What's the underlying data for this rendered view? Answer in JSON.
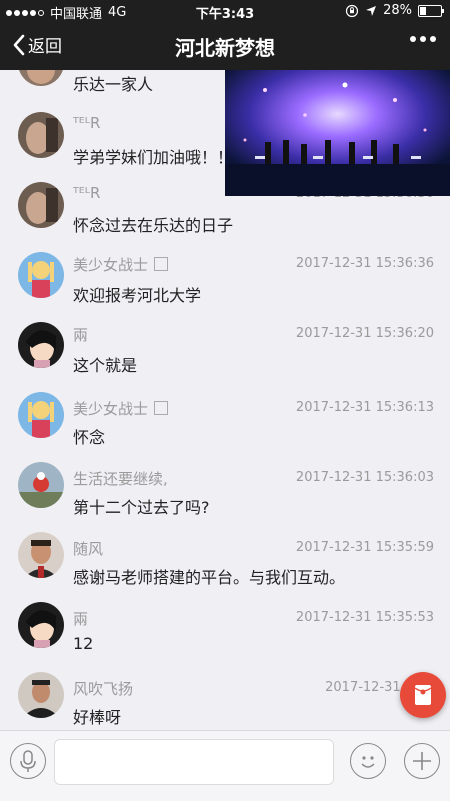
{
  "status_bar": {
    "carrier": "中国联通",
    "network": "4G",
    "time": "下午3:43",
    "battery": "28%",
    "battery_fraction": 0.28
  },
  "nav": {
    "back_label": "返回",
    "title": "河北新梦想"
  },
  "messages": [
    {
      "name": "",
      "time": "",
      "text": "乐达一家人",
      "avatar": "photo-avatar"
    },
    {
      "name": "ᵀᴱᴸR",
      "time": "",
      "text": "学弟学妹们加油哦！！",
      "avatar": "photo-avatar"
    },
    {
      "name": "ᵀᴱᴸR",
      "time": "2017-12-31 15:36:36",
      "text": "怀念过去在乐达的日子",
      "avatar": "photo-avatar"
    },
    {
      "name": "美少女战士",
      "time": "2017-12-31 15:36:36",
      "text": "欢迎报考河北大学",
      "avatar": "cartoon-avatar"
    },
    {
      "name": "兩",
      "time": "2017-12-31 15:36:20",
      "text": "这个就是",
      "avatar": "cartoon-avatar"
    },
    {
      "name": "美少女战士",
      "time": "2017-12-31 15:36:13",
      "text": "怀念",
      "avatar": "cartoon-avatar"
    },
    {
      "name": "生活还要继续,",
      "time": "2017-12-31 15:36:03",
      "text": "第十二个过去了吗?",
      "avatar": "photo-avatar"
    },
    {
      "name": "随风",
      "time": "2017-12-31 15:35:59",
      "text": "感谢马老师搭建的平台。与我们互动。",
      "avatar": "photo-avatar"
    },
    {
      "name": "兩",
      "time": "2017-12-31 15:35:53",
      "text": "12",
      "avatar": "cartoon-avatar"
    },
    {
      "name": "风吹飞扬",
      "time": "2017-12-31 15:3",
      "text": "好棒呀",
      "avatar": "photo-avatar"
    }
  ],
  "icons": {
    "back": "chevron-left-icon",
    "more": "more-dots-icon",
    "mic": "microphone-icon",
    "emoji": "smiley-icon",
    "plus": "plus-icon",
    "red_packet": "red-packet-icon"
  },
  "colors": {
    "bar": "#1f1f1f",
    "background": "#efeff4",
    "red_packet": "#e84a3a"
  }
}
